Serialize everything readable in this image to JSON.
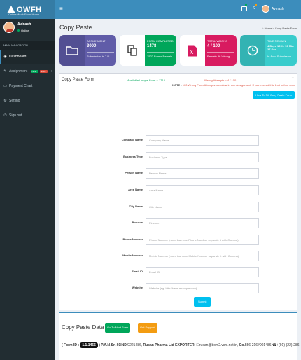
{
  "brand": {
    "logo": "OWFH",
    "tagline": "Online Work From Home"
  },
  "topbar": {
    "user_name": "Avinash"
  },
  "sidebar": {
    "user_name": "Avinash",
    "status": "Online",
    "section_title": "MAIN NAVIGATION",
    "items": [
      {
        "label": "Dashboard",
        "icon": "dashboard-icon",
        "active": true
      },
      {
        "label": "Assignment",
        "icon": "edit-icon",
        "badges": [
          {
            "text": "NEW",
            "color": "#00a65a"
          },
          {
            "text": "2022",
            "color": "#dd4b39"
          }
        ]
      },
      {
        "label": "Payment Chart",
        "icon": "card-icon"
      },
      {
        "label": "Setting",
        "icon": "gear-icon"
      },
      {
        "label": "Sign out",
        "icon": "power-icon"
      }
    ]
  },
  "page": {
    "title": "Copy Paste",
    "breadcrumb_home": "Home",
    "breadcrumb_current": "Copy Paste Form"
  },
  "info_boxes": [
    {
      "label": "ASSIGNMENT",
      "value": "3000",
      "desc": "Submission in 7 D...",
      "color": "#605ca8",
      "icon": "folder-icon"
    },
    {
      "label": "FORM COMPLETED",
      "value": "1478",
      "desc": "1522 Forms Remain",
      "color": "#00a65a",
      "icon": "copy-icon"
    },
    {
      "label": "TOTAL WRONG",
      "value": "4 / 100",
      "desc": "Remain 96 Wrong ...",
      "color": "#d81b60",
      "icon": "excel-icon"
    },
    {
      "label": "TIME REMAIN",
      "value": "4 Days 15 Hr 19 Min 27 Sec",
      "desc": "In Auto Submission",
      "color": "#39cccc",
      "icon": "clock-icon"
    }
  ],
  "form": {
    "title": "Copy Paste Form",
    "unique_text": "Available Unique Form = 1714",
    "wrong_text": "Wrong Attempts = 4 / 100",
    "note_prefix": "NOTE :",
    "note_text": " 100 Wrong Form Attempts are allow in one Assignment, If you exceed this limit before com",
    "howto_label": "How To Fill Copy Paste Form",
    "submit_label": "Submit",
    "fields": [
      {
        "label": "Company Name",
        "placeholder": "Company Name"
      },
      {
        "label": "Business Type",
        "placeholder": "Business Type"
      },
      {
        "label": "Person Name",
        "placeholder": "Person Name"
      },
      {
        "label": "Area Name",
        "placeholder": "Area Name"
      },
      {
        "label": "City Name",
        "placeholder": "City Name"
      },
      {
        "label": "Pincode",
        "placeholder": "Pincode"
      },
      {
        "label": "Phone Number",
        "placeholder": "Phone Number (more than one Phone Number separate it with Comma)"
      },
      {
        "label": "Mobile Number",
        "placeholder": "Mobile Number (more than one Mobile Number separate it with Comma)"
      },
      {
        "label": "Email ID",
        "placeholder": "Email ID"
      },
      {
        "label": "Website",
        "placeholder": "Website (eg. http://www.example.com)"
      }
    ]
  },
  "data_panel": {
    "title": "Copy Paste Data",
    "next_form_label": "Go To Next Form",
    "support_label": "Get Support",
    "form_id_label": "( Form ID :",
    "form_id": "1.1.1466",
    "line_rest_1": ") P.A.N-Sr.-91",
    "ind_label": "IND",
    "line_rest_2": "/0221486,",
    "company": "Rusan Pharma Ltd EXPORTER",
    "line_rest_3": ", ☐rusan@bom2.vsnl.net.in,",
    "co_label": "Co.",
    "line_rest_4": "556-216#001486,☎+(91)-(22)-286"
  }
}
